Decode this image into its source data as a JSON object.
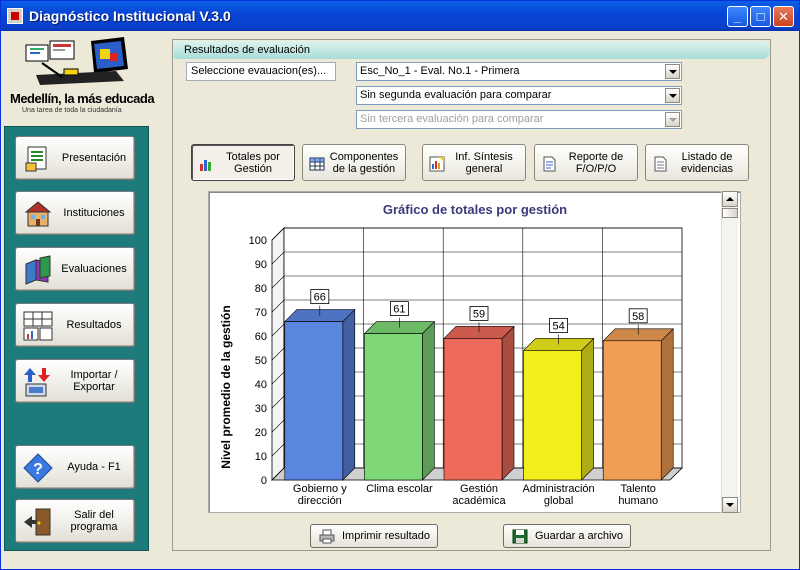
{
  "window": {
    "title": "Diagnóstico Institucional V.3.0",
    "controls": {
      "minimize": "_",
      "maximize": "□",
      "close": "✕"
    }
  },
  "logo": {
    "text": "Medellín, la más educada",
    "subtitle": "Una tarea de toda la ciudadanía"
  },
  "sidebar": {
    "items": [
      {
        "label": "Presentación",
        "icon": "presentation-icon"
      },
      {
        "label": "Instituciones",
        "icon": "school-building-icon"
      },
      {
        "label": "Evaluaciones",
        "icon": "books-icon"
      },
      {
        "label": "Resultados",
        "icon": "results-table-icon"
      },
      {
        "label": "Importar / Exportar",
        "icon": "import-export-icon"
      },
      {
        "label": "Ayuda - F1",
        "icon": "help-icon"
      },
      {
        "label": "Salir del programa",
        "icon": "exit-door-icon"
      }
    ]
  },
  "main": {
    "section_title": "Resultados de evaluación",
    "select_label": "Seleccione evauacion(es)...",
    "combos": [
      {
        "value": "Esc_No_1 - Eval. No.1 - Primera",
        "enabled": true
      },
      {
        "value": "Sin segunda evaluación para comparar",
        "enabled": true
      },
      {
        "value": "Sin tercera evaluación para comparar",
        "enabled": false
      }
    ],
    "tabs": [
      {
        "label": "Totales por Gestión",
        "icon": "bar-chart-icon",
        "active": true
      },
      {
        "label": "Componentes de la gestión",
        "icon": "grid-icon",
        "active": false
      },
      {
        "label": "Inf. Síntesis general",
        "icon": "report-chart-icon",
        "active": false
      },
      {
        "label": "Reporte de F/O/P/O",
        "icon": "document-icon",
        "active": false
      },
      {
        "label": "Listado de evidencias",
        "icon": "list-document-icon",
        "active": false
      }
    ],
    "actions": {
      "print": "Imprimir resultado",
      "save": "Guardar a archivo"
    }
  },
  "chart_data": {
    "type": "bar",
    "title": "Gráfico de totales por gestión",
    "ylabel": "Nivel promedio de la gestión",
    "xlabel": "",
    "ylim": [
      0,
      100
    ],
    "yticks": [
      0,
      10,
      20,
      30,
      40,
      50,
      60,
      70,
      80,
      90,
      100
    ],
    "grid": true,
    "categories": [
      [
        "Gobierno y",
        "dirección"
      ],
      [
        "Clima escolar"
      ],
      [
        "Gestión",
        "académica"
      ],
      [
        "Administración",
        "global"
      ],
      [
        "Talento",
        "humano"
      ]
    ],
    "values": [
      66,
      61,
      59,
      54,
      58
    ],
    "colors": [
      "#5b86e0",
      "#7fd877",
      "#ee6a5a",
      "#f2ee1c",
      "#f09e55"
    ]
  }
}
